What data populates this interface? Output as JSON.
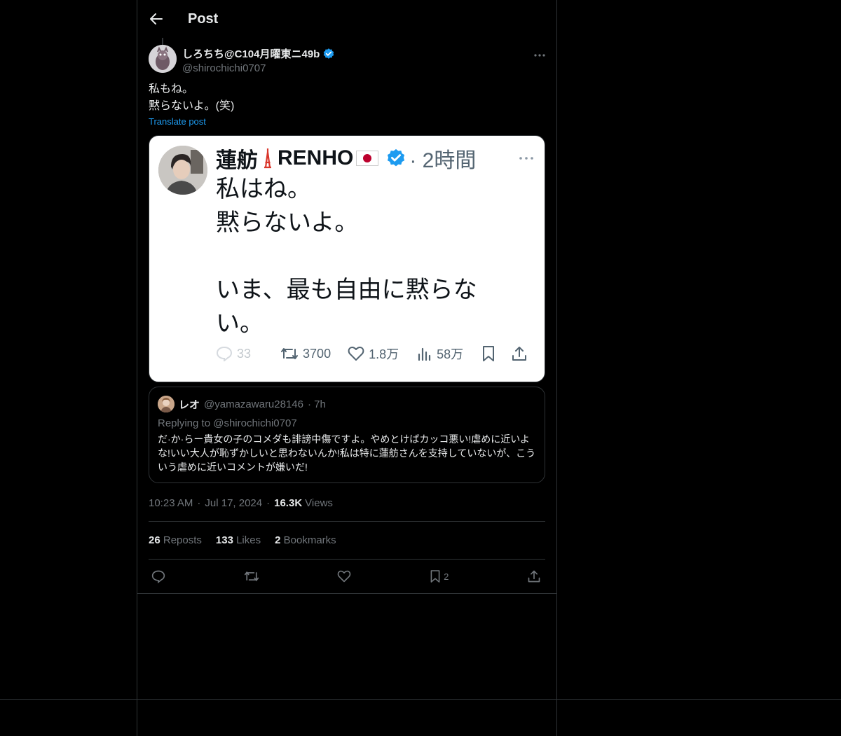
{
  "header": {
    "title": "Post"
  },
  "author": {
    "display_name": "しろちち@C104月曜東ニ49b",
    "handle": "@shirochichi0707"
  },
  "post": {
    "lines": [
      "私もね。",
      "黙らないよ。(笑)"
    ],
    "translate_label": "Translate post"
  },
  "embedded_screenshot": {
    "name": "蓮舫",
    "name_latin": "RENHO",
    "time": "· 2時間",
    "lines": [
      "私はね。",
      "黙らないよ。",
      "",
      "いま、最も自由に黙らな",
      "い。"
    ],
    "stats": {
      "replies": "33",
      "reposts": "3700",
      "likes": "1.8万",
      "views": "58万"
    }
  },
  "quote": {
    "name": "レオ",
    "handle": "@yamazawaru28146",
    "time": "· 7h",
    "replying_to": "Replying to @shirochichi0707",
    "text": "だ·か·らー貴女の子のコメダも誹謗中傷ですよ。やめとけばカッコ悪い!虐めに近いよな!いい大人が恥ずかしいと思わないんか!私は特に蓮舫さんを支持していないが、こういう虐めに近いコメントが嫌いだ!"
  },
  "meta": {
    "time": "10:23 AM",
    "date": "Jul 17, 2024",
    "views_count": "16.3K",
    "views_label": "Views"
  },
  "counts": {
    "reposts": "26",
    "reposts_label": "Reposts",
    "likes": "133",
    "likes_label": "Likes",
    "bookmarks": "2",
    "bookmarks_label": "Bookmarks"
  },
  "actions": {
    "bookmark_count": "2"
  },
  "colors": {
    "accent": "#1d9bf0",
    "text": "#e7e9ea",
    "muted": "#71767b",
    "border": "#2f3336"
  }
}
